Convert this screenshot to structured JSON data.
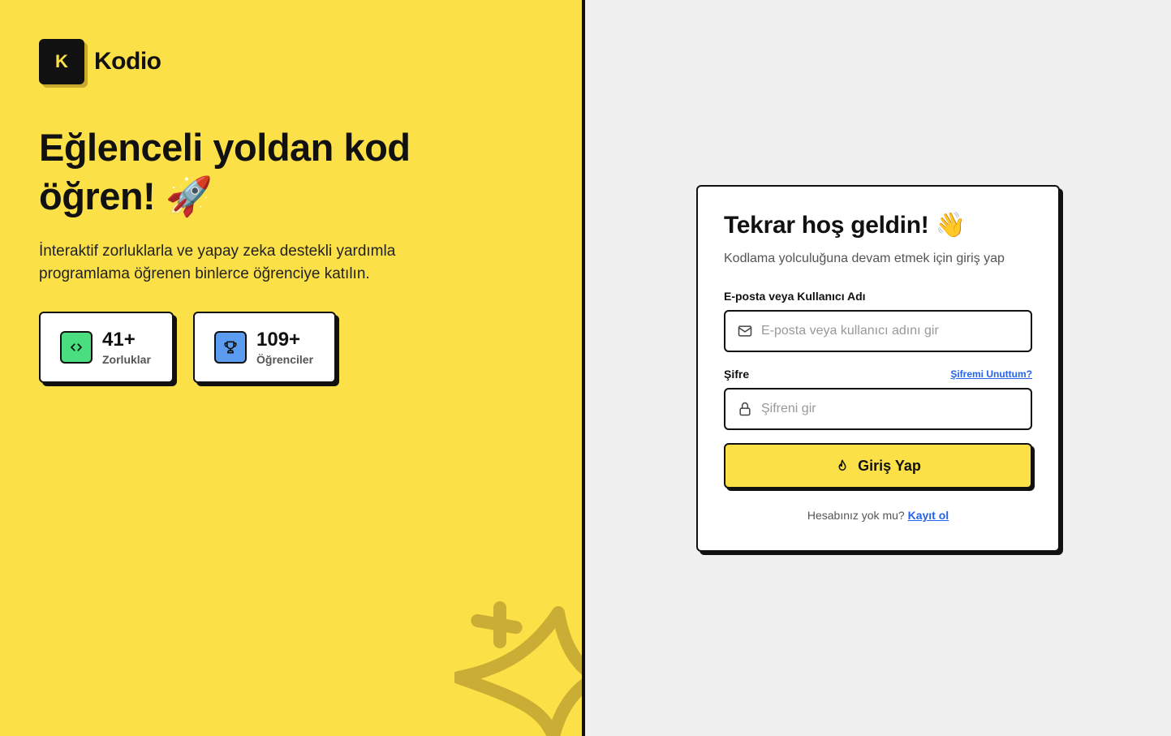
{
  "brand": {
    "logo_letter": "K",
    "name": "Kodio",
    "color_yellow": "#fbe047"
  },
  "hero": {
    "title": "Eğlenceli yoldan kod öğren! 🚀",
    "subtitle": "İnteraktif zorluklarla ve yapay zeka destekli yardımla programlama öğrenen binlerce öğrenciye katılın."
  },
  "stats": [
    {
      "value": "41+",
      "label": "Zorluklar",
      "icon": "code-icon",
      "color": "#4ade80"
    },
    {
      "value": "109+",
      "label": "Öğrenciler",
      "icon": "trophy-icon",
      "color": "#5b9cf0"
    }
  ],
  "login": {
    "title": "Tekrar hoş geldin! 👋",
    "subtitle": "Kodlama yolculuğuna devam etmek için giriş yap",
    "email_label": "E-posta veya Kullanıcı Adı",
    "email_placeholder": "E-posta veya kullanıcı adını gir",
    "email_icon": "mail-icon",
    "password_label": "Şifre",
    "forgot_label": "Şifremi Unuttum?",
    "password_placeholder": "Şifreni gir",
    "password_icon": "lock-icon",
    "submit_label": "Giriş Yap",
    "submit_icon": "flame-icon",
    "no_account_text": "Hesabınız yok mu?",
    "signup_label": "Kayıt ol"
  }
}
